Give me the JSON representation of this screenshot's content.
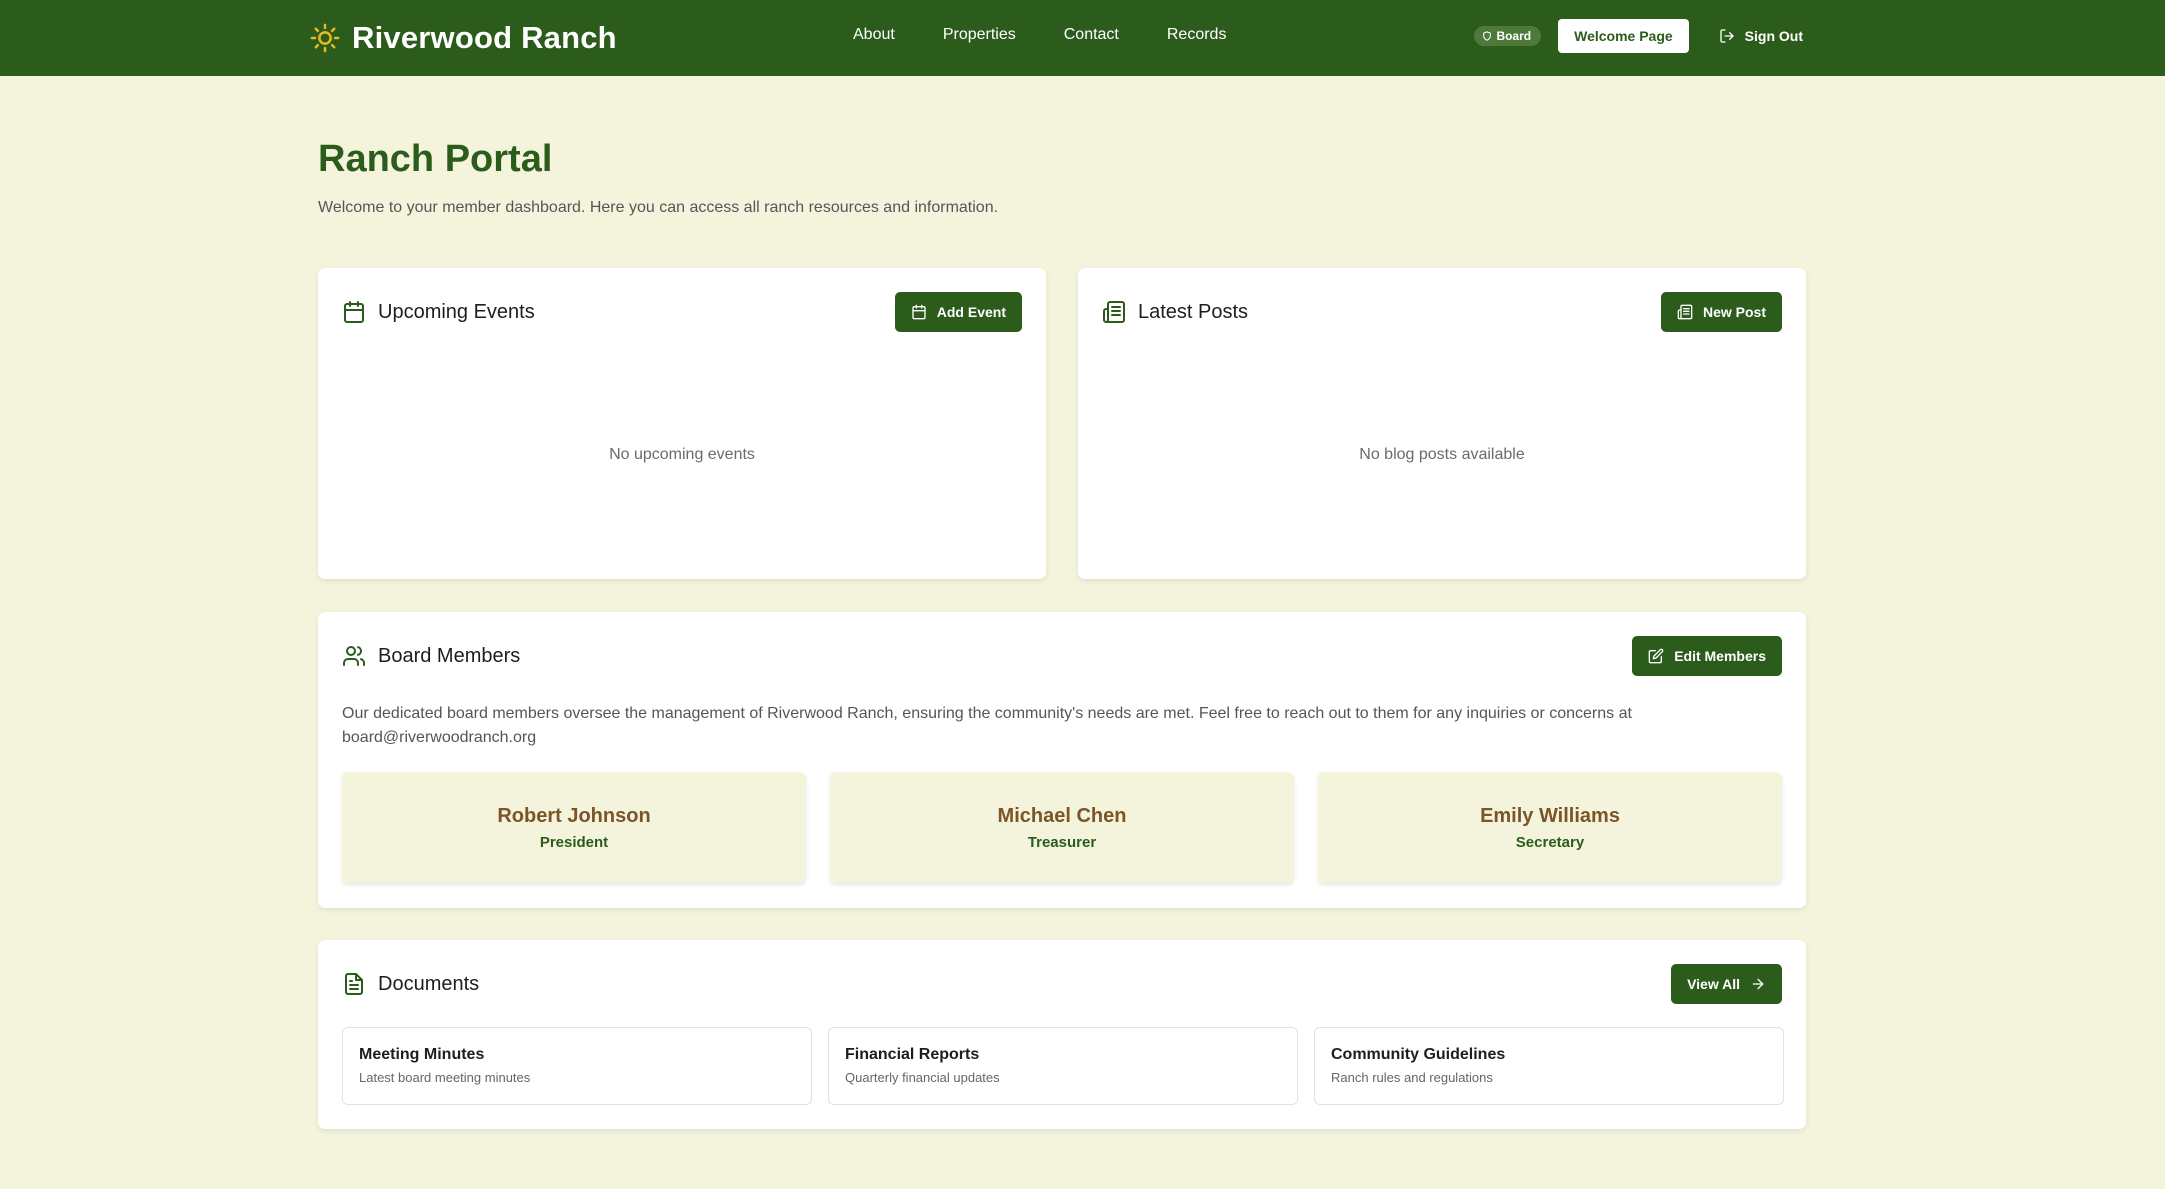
{
  "header": {
    "brand": "Riverwood Ranch",
    "nav": [
      "About",
      "Properties",
      "Contact",
      "Records"
    ],
    "badge": "Board",
    "welcome_label": "Welcome Page",
    "signout_label": "Sign Out"
  },
  "page": {
    "title": "Ranch Portal",
    "subtitle": "Welcome to your member dashboard. Here you can access all ranch resources and information."
  },
  "events": {
    "title": "Upcoming Events",
    "button_label": "Add Event",
    "empty_text": "No upcoming events"
  },
  "posts": {
    "title": "Latest Posts",
    "button_label": "New Post",
    "empty_text": "No blog posts available"
  },
  "board": {
    "title": "Board Members",
    "button_label": "Edit Members",
    "description": "Our dedicated board members oversee the management of Riverwood Ranch, ensuring the community's needs are met. Feel free to reach out to them for any inquiries or concerns at board@riverwoodranch.org",
    "members": [
      {
        "name": "Robert Johnson",
        "role": "President"
      },
      {
        "name": "Michael Chen",
        "role": "Treasurer"
      },
      {
        "name": "Emily Williams",
        "role": "Secretary"
      }
    ]
  },
  "documents": {
    "title": "Documents",
    "button_label": "View All",
    "items": [
      {
        "title": "Meeting Minutes",
        "description": "Latest board meeting minutes"
      },
      {
        "title": "Financial Reports",
        "description": "Quarterly financial updates"
      },
      {
        "title": "Community Guidelines",
        "description": "Ranch rules and regulations"
      }
    ]
  },
  "colors": {
    "primary": "#2c5c1c",
    "background": "#f4f4dd",
    "member_name": "#7a5528",
    "sun_icon": "#e8b923"
  }
}
